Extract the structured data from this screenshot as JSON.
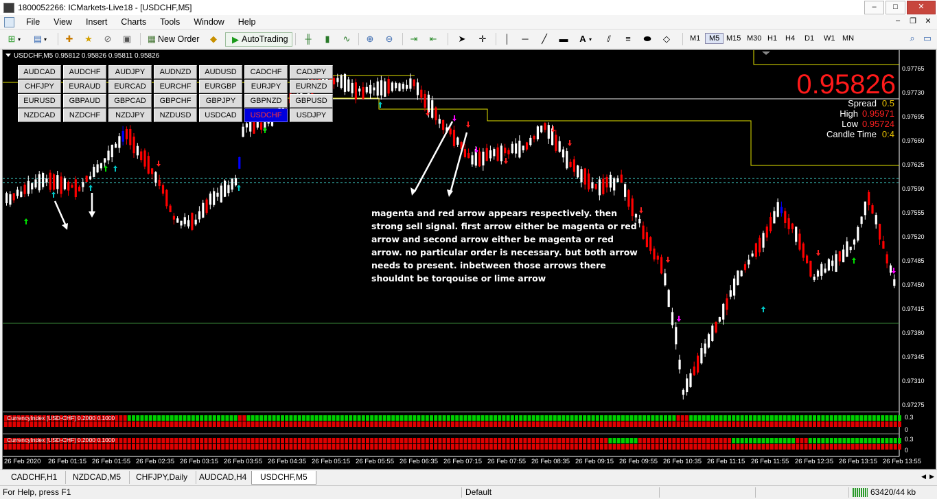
{
  "window": {
    "title": "1800052266: ICMarkets-Live18 - [USDCHF,M5]",
    "buttons": [
      "–",
      "□",
      "✕"
    ]
  },
  "menu": {
    "items": [
      "File",
      "View",
      "Insert",
      "Charts",
      "Tools",
      "Window",
      "Help"
    ],
    "right_buttons": [
      "–",
      "❐",
      "✕"
    ]
  },
  "toolbar": {
    "new_order_label": "New Order",
    "autotrading_label": "AutoTrading",
    "timeframes": [
      "M1",
      "M5",
      "M15",
      "M30",
      "H1",
      "H4",
      "D1",
      "W1",
      "MN"
    ],
    "active_timeframe": "M5"
  },
  "chart": {
    "header": "USDCHF,M5  0.95812 0.95826 0.95811 0.95826",
    "pairs": [
      "AUDCAD",
      "AUDCHF",
      "AUDJPY",
      "AUDNZD",
      "AUDUSD",
      "CADCHF",
      "CADJPY",
      "CHFJPY",
      "EURAUD",
      "EURCAD",
      "EURCHF",
      "EURGBP",
      "EURJPY",
      "EURNZD",
      "EURUSD",
      "GBPAUD",
      "GBPCAD",
      "GBPCHF",
      "GBPJPY",
      "GBPNZD",
      "GBPUSD",
      "NZDCAD",
      "NZDCHF",
      "NZDJPY",
      "NZDUSD",
      "USDCAD",
      "USDCHF",
      "USDJPY"
    ],
    "selected_pair": "USDCHF",
    "big_price": "0.95826",
    "info": {
      "spread_label": "Spread",
      "spread_value": "0.5",
      "high_label": "High",
      "high_value": "0.95971",
      "low_label": "Low",
      "low_value": "0.95724",
      "candle_time_label": "Candle Time",
      "candle_time_value": "0:4"
    },
    "annotation": "magenta and red arrow appears respectively. then strong sell signal. first arrow either be magenta or red arrow and second arrow either be magenta or red arrow. no particular order is necessary. but both arrow needs to present. inbetween those arrows there shouldnt be torqouise or lime arrow",
    "price_levels": [
      "0.97765",
      "0.97730",
      "0.97695",
      "0.97660",
      "0.97625",
      "0.97590",
      "0.97555",
      "0.97520",
      "0.97485",
      "0.97450",
      "0.97415",
      "0.97380",
      "0.97345",
      "0.97310",
      "0.97275"
    ],
    "time_labels": [
      "26 Feb 2020",
      "26 Feb 01:15",
      "26 Feb 01:55",
      "26 Feb 02:35",
      "26 Feb 03:15",
      "26 Feb 03:55",
      "26 Feb 04:35",
      "26 Feb 05:15",
      "26 Feb 05:55",
      "26 Feb 06:35",
      "26 Feb 07:15",
      "26 Feb 07:55",
      "26 Feb 08:35",
      "26 Feb 09:15",
      "26 Feb 09:55",
      "26 Feb 10:35",
      "26 Feb 11:15",
      "26 Feb 11:55",
      "26 Feb 12:35",
      "26 Feb 13:15",
      "26 Feb 13:55"
    ],
    "indicator_label": "CurrencyIndex [USD-CHF] 0.2000 0.1000",
    "indicator_scale": [
      "0.3",
      "0"
    ],
    "colors": {
      "bull": "#ffffff",
      "bear": "#ff0000",
      "strong_bull": "#0000ff",
      "arrow_cyan": "#00c8c8",
      "arrow_lime": "#00e000",
      "arrow_red": "#ff2020",
      "arrow_magenta": "#ff00ff",
      "level_line": "#e6e600",
      "dotted_line": "#40d8d0"
    }
  },
  "tabs": [
    "CADCHF,H1",
    "NZDCAD,M5",
    "CHFJPY,Daily",
    "AUDCAD,H4",
    "USDCHF,M5"
  ],
  "active_tab": "USDCHF,M5",
  "status": {
    "help": "For Help, press F1",
    "profile": "Default",
    "traffic": "63420/44 kb"
  }
}
